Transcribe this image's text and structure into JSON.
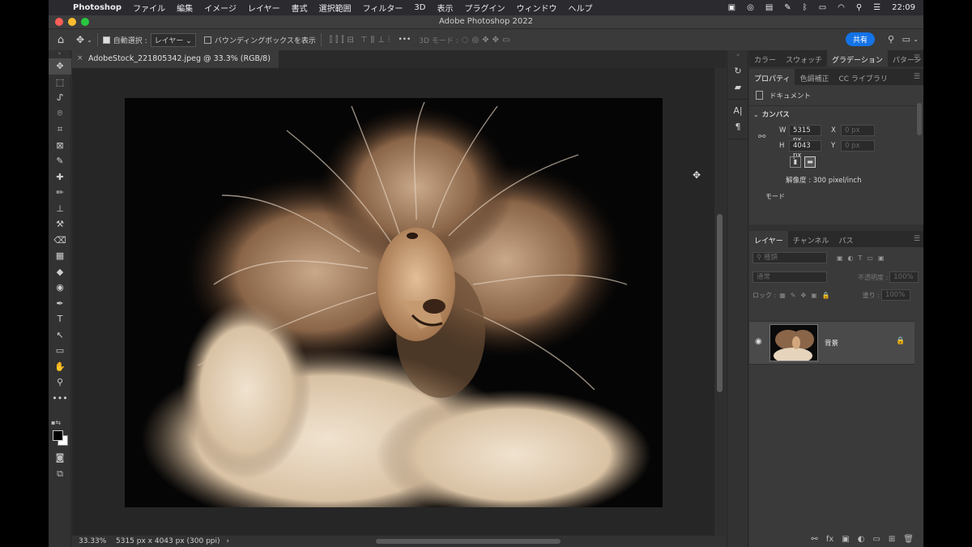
{
  "menubar": {
    "apple": "",
    "app_name": "Photoshop",
    "items": [
      "ファイル",
      "編集",
      "イメージ",
      "レイヤー",
      "書式",
      "選択範囲",
      "フィルター",
      "3D",
      "表示",
      "プラグイン",
      "ウィンドウ",
      "ヘルプ"
    ],
    "clock": "22:09"
  },
  "window": {
    "title": "Adobe Photoshop 2022"
  },
  "options": {
    "auto_select_label": "自動選択 :",
    "auto_select_value": "レイヤー",
    "transform_label": "バウンディングボックスを表示",
    "more": "•••",
    "mode_3d": "3D モード :",
    "share": "共有"
  },
  "document": {
    "tab_label": "AdobeStock_221805342.jpeg @ 33.3% (RGB/8)",
    "close": "×"
  },
  "status": {
    "zoom": "33.33%",
    "dims": "5315 px x 4043 px (300 ppi)",
    "arrow": "›"
  },
  "tools": [
    "✥",
    "⬚",
    "ᔑ",
    "⌾",
    "⌗",
    "⊠",
    "✎",
    "✚",
    "✏",
    "⊥",
    "⚒",
    "⌫",
    "▦",
    "◆",
    "◉",
    "✒",
    "T",
    "↖",
    "▭",
    "✋",
    "⚲",
    "•••"
  ],
  "panel_top": {
    "tabs": [
      "カラー",
      "スウォッチ",
      "グラデーション",
      "パターン"
    ],
    "active_tab": 2
  },
  "properties": {
    "tabs": [
      "プロパティ",
      "色調補正",
      "CC ライブラリ"
    ],
    "doc_label": "ドキュメント",
    "canvas_label": "カンバス",
    "w_label": "W",
    "w_value": "5315 px",
    "h_label": "H",
    "h_value": "4043 px",
    "x_label": "X",
    "x_value": "0 px",
    "y_label": "Y",
    "y_value": "0 px",
    "resolution": "解像度 : 300 pixel/inch",
    "mode": "モード"
  },
  "layers": {
    "tabs": [
      "レイヤー",
      "チャンネル",
      "パス"
    ],
    "filter_placeholder": "種類",
    "blend_mode": "通常",
    "opacity_label": "不透明度 :",
    "opacity_value": "100%",
    "lock_label": "ロック :",
    "fill_label": "塗り :",
    "fill_value": "100%",
    "layer_name": "背景"
  },
  "colors": {
    "accent": "#1473e6",
    "panel": "#323232",
    "canvas_bg": "#262626"
  }
}
